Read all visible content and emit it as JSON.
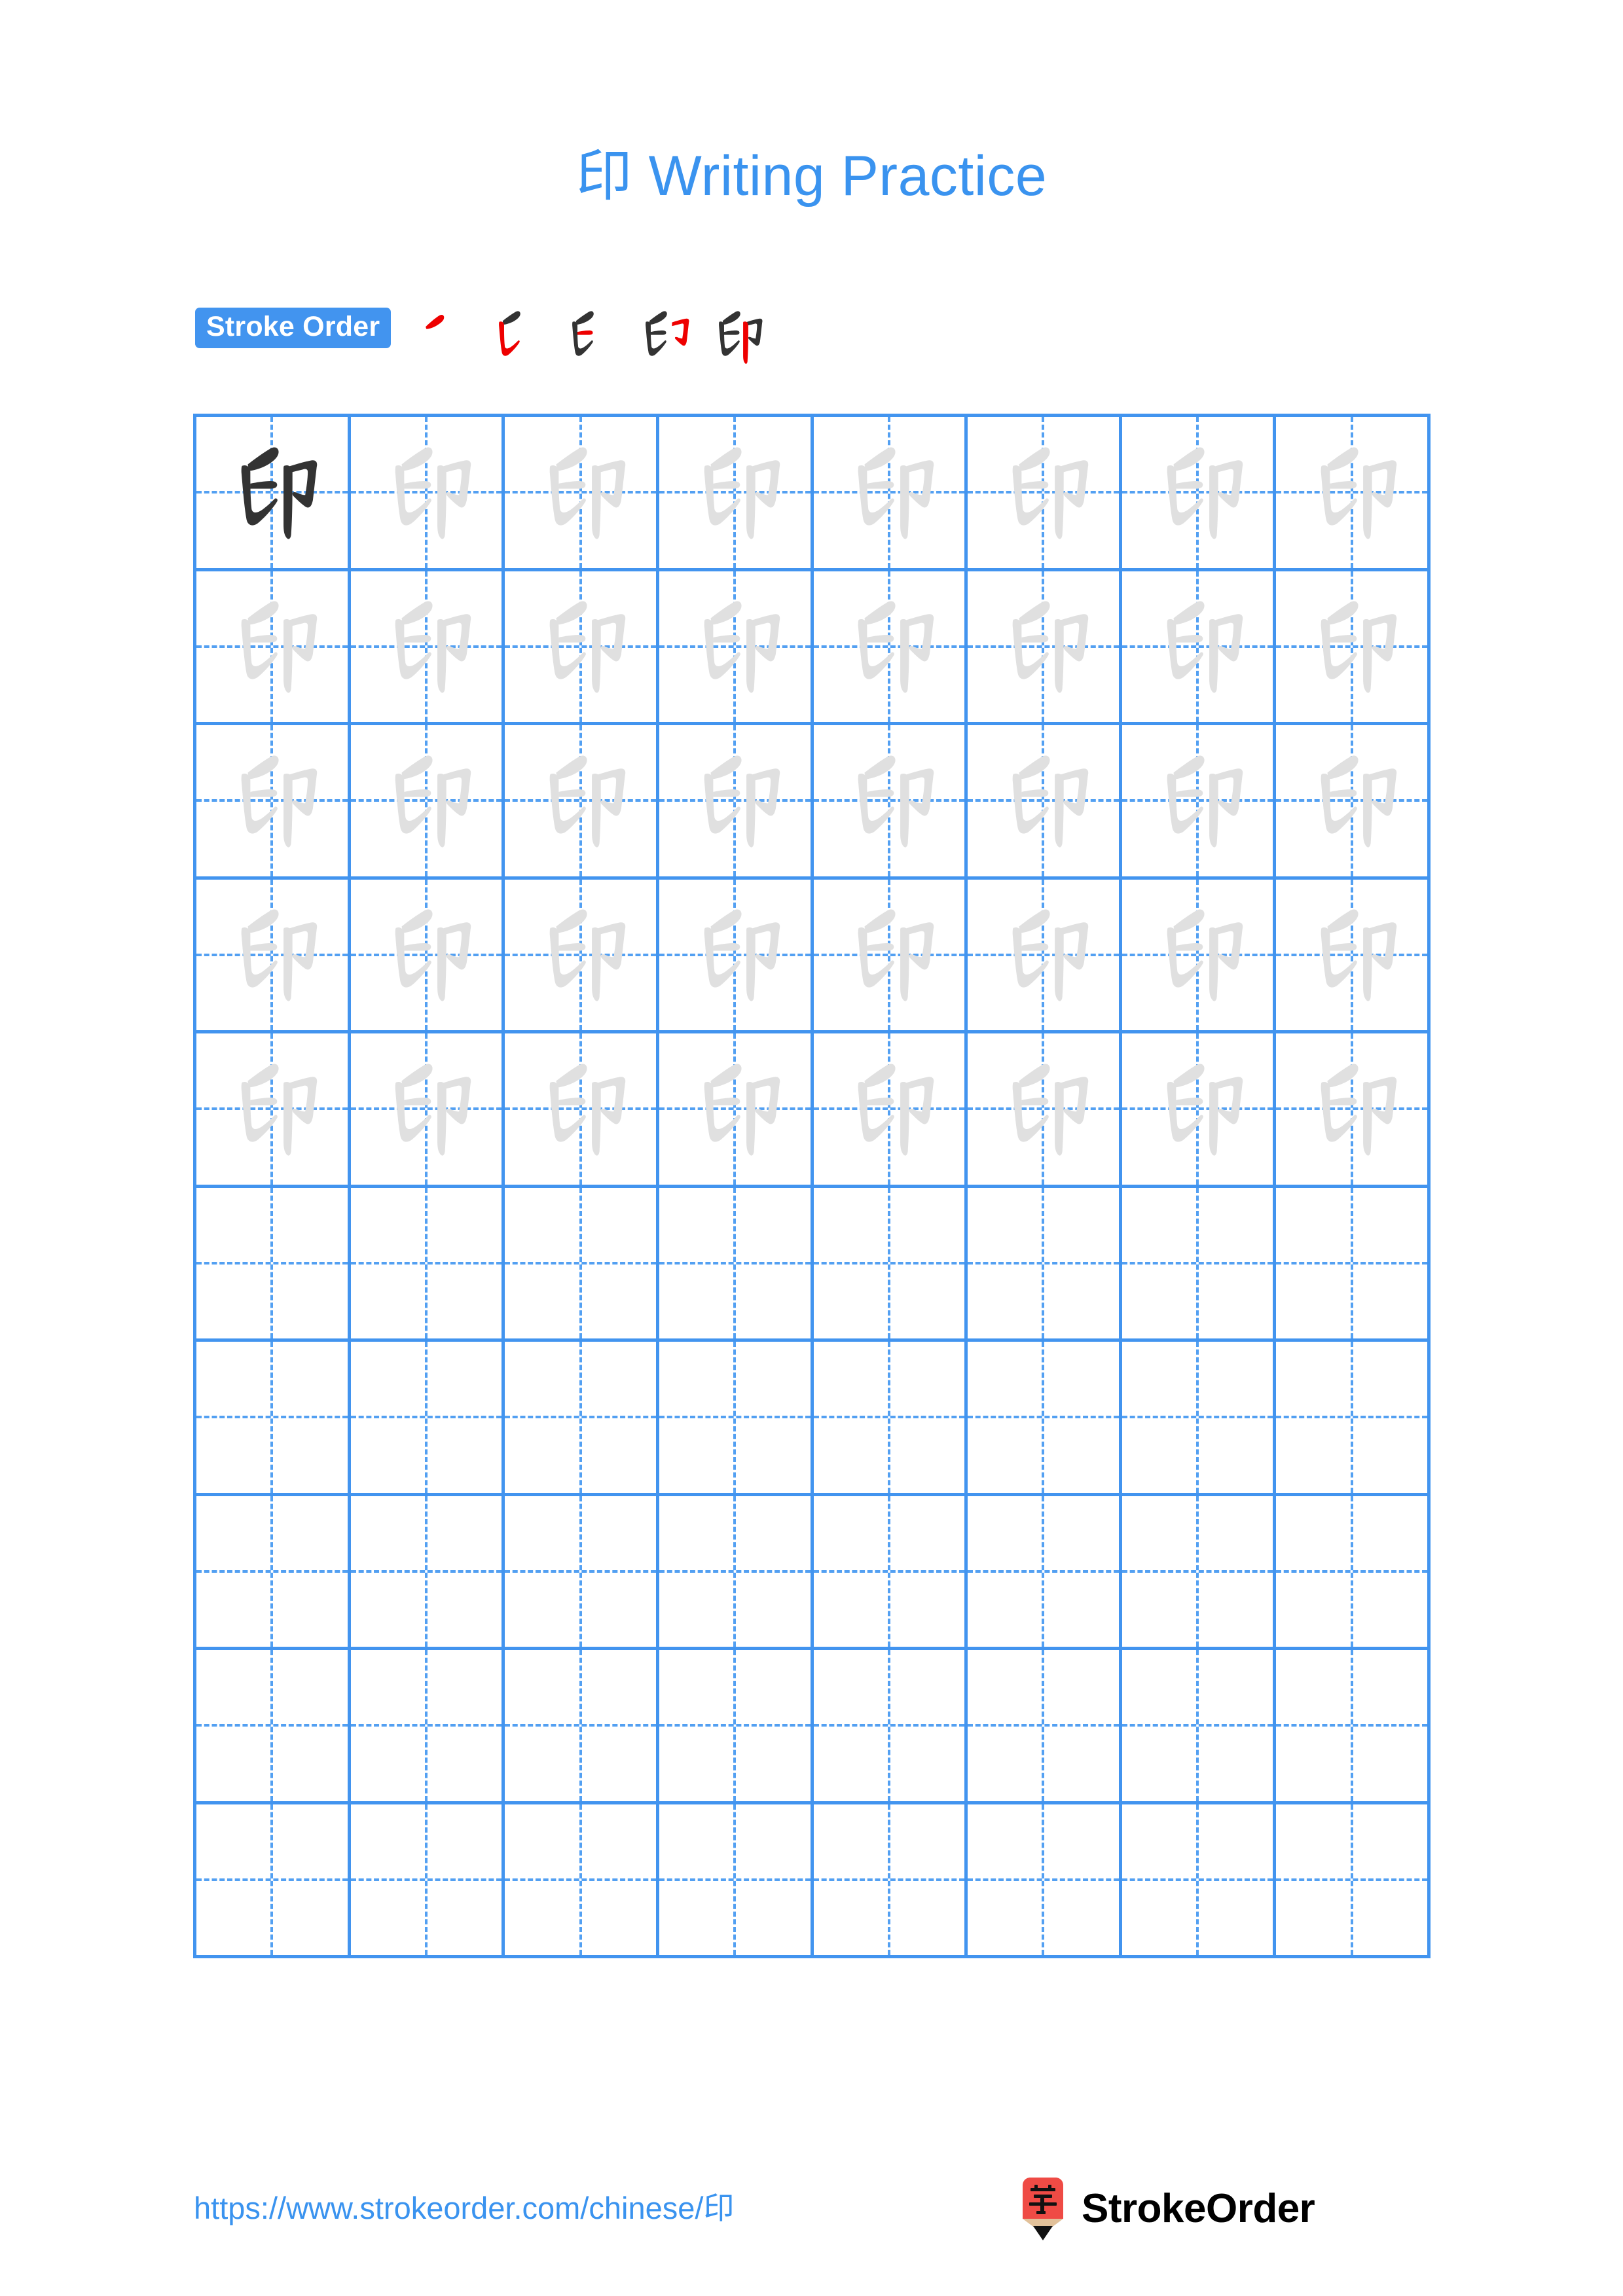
{
  "page": {
    "character": "印",
    "title": "印 Writing Practice",
    "title_character": "印",
    "title_suffix": " Writing Practice",
    "background_color": "#ffffff",
    "accent_color": "#3a93ef",
    "grid_line_color": "#4294ef",
    "trace_color": "#e0e0e0",
    "model_color": "#333333",
    "highlight_stroke_color": "#ee0000"
  },
  "stroke_order": {
    "label": "Stroke Order",
    "badge_background": "#4294ef",
    "badge_text_color": "#ffffff",
    "total_strokes": 5,
    "steps": [
      {
        "index": 1,
        "strokes_shown": 1,
        "new_stroke": "撇 (piě)"
      },
      {
        "index": 2,
        "strokes_shown": 2,
        "new_stroke": "竖 (shù)"
      },
      {
        "index": 3,
        "strokes_shown": 3,
        "new_stroke": "横 (héng)"
      },
      {
        "index": 4,
        "strokes_shown": 4,
        "new_stroke": "横折钩 (héngzhégōu)"
      },
      {
        "index": 5,
        "strokes_shown": 5,
        "new_stroke": "竖 (shù)"
      }
    ]
  },
  "grid": {
    "columns": 8,
    "rows": 10,
    "cells": [
      [
        "model",
        "trace",
        "trace",
        "trace",
        "trace",
        "trace",
        "trace",
        "trace"
      ],
      [
        "trace",
        "trace",
        "trace",
        "trace",
        "trace",
        "trace",
        "trace",
        "trace"
      ],
      [
        "trace",
        "trace",
        "trace",
        "trace",
        "trace",
        "trace",
        "trace",
        "trace"
      ],
      [
        "trace",
        "trace",
        "trace",
        "trace",
        "trace",
        "trace",
        "trace",
        "trace"
      ],
      [
        "trace",
        "trace",
        "trace",
        "trace",
        "trace",
        "trace",
        "trace",
        "trace"
      ],
      [
        "empty",
        "empty",
        "empty",
        "empty",
        "empty",
        "empty",
        "empty",
        "empty"
      ],
      [
        "empty",
        "empty",
        "empty",
        "empty",
        "empty",
        "empty",
        "empty",
        "empty"
      ],
      [
        "empty",
        "empty",
        "empty",
        "empty",
        "empty",
        "empty",
        "empty",
        "empty"
      ],
      [
        "empty",
        "empty",
        "empty",
        "empty",
        "empty",
        "empty",
        "empty",
        "empty"
      ],
      [
        "empty",
        "empty",
        "empty",
        "empty",
        "empty",
        "empty",
        "empty",
        "empty"
      ]
    ]
  },
  "footer": {
    "url_text": "https://www.strokeorder.com/chinese/印",
    "url_prefix": "https://www.strokeorder.com/chinese/",
    "url_character": "印",
    "brand_name": "StrokeOrder",
    "logo_character": "字",
    "logo_body_color": "#ef4b45",
    "logo_tip_color": "#e2c19a",
    "logo_point_color": "#111111"
  }
}
